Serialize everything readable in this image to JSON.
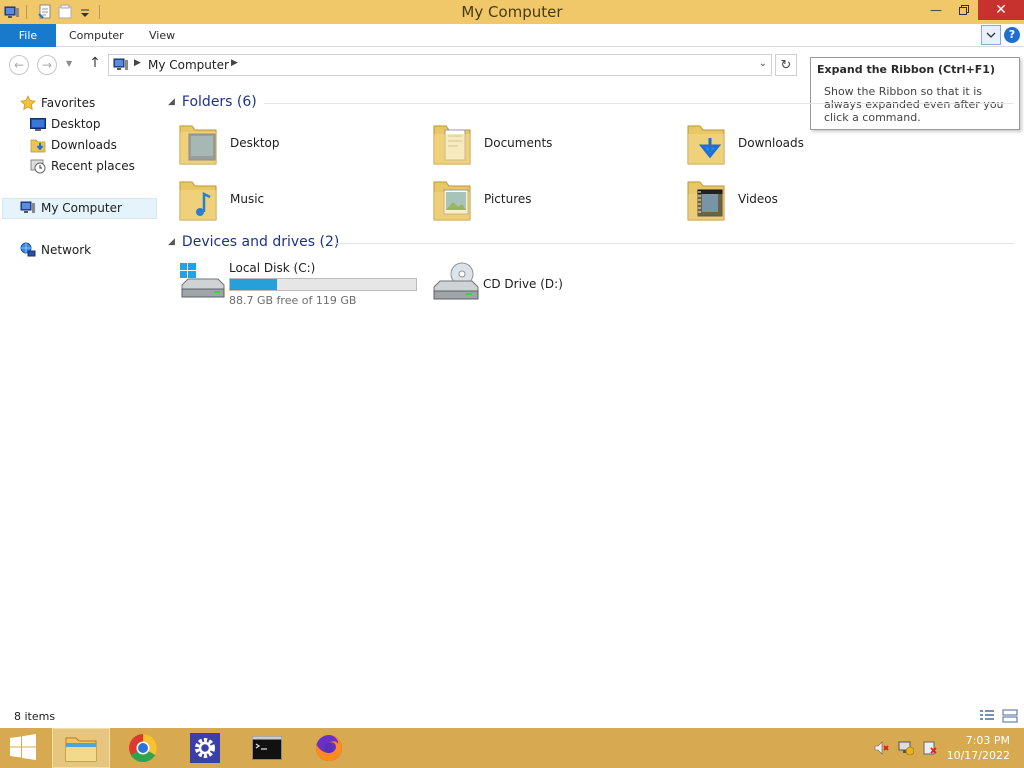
{
  "window": {
    "title": "My Computer"
  },
  "ribbon": {
    "tabs": [
      {
        "label": "File"
      },
      {
        "label": "Computer"
      },
      {
        "label": "View"
      }
    ],
    "help_label": "?"
  },
  "address": {
    "path": "My Computer"
  },
  "tooltip": {
    "title": "Expand the Ribbon (Ctrl+F1)",
    "body": "Show the Ribbon so that it is always expanded even after you click a command."
  },
  "nav_pane": {
    "favorites_label": "Favorites",
    "favorites": [
      {
        "label": "Desktop",
        "icon": "desktop-icon"
      },
      {
        "label": "Downloads",
        "icon": "downloads-icon"
      },
      {
        "label": "Recent places",
        "icon": "recent-places-icon"
      }
    ],
    "computer_label": "My Computer",
    "network_label": "Network"
  },
  "folders": {
    "header": "Folders (6)",
    "items": [
      {
        "label": "Desktop",
        "icon": "desktop-folder-icon"
      },
      {
        "label": "Documents",
        "icon": "documents-folder-icon"
      },
      {
        "label": "Downloads",
        "icon": "downloads-folder-icon"
      },
      {
        "label": "Music",
        "icon": "music-folder-icon"
      },
      {
        "label": "Pictures",
        "icon": "pictures-folder-icon"
      },
      {
        "label": "Videos",
        "icon": "videos-folder-icon"
      }
    ]
  },
  "drives": {
    "header": "Devices and drives (2)",
    "items": [
      {
        "label": "Local Disk (C:)",
        "free_text": "88.7 GB free of 119 GB",
        "used_fraction": 0.255,
        "icon": "local-disk-icon"
      },
      {
        "label": "CD Drive (D:)",
        "icon": "cd-drive-icon"
      }
    ]
  },
  "status": {
    "item_count": "8 items"
  },
  "taskbar": {
    "apps": [
      "file-explorer",
      "chrome",
      "settings",
      "command-prompt",
      "firefox"
    ],
    "time": "7:03 PM",
    "date": "10/17/2022"
  },
  "colors": {
    "title_bar": "#f0c86a",
    "file_tab": "#1979ca",
    "taskbar": "#d7a951",
    "group_header": "#1e3287",
    "drive_fill": "#26a0da",
    "close_button": "#c7312e"
  }
}
